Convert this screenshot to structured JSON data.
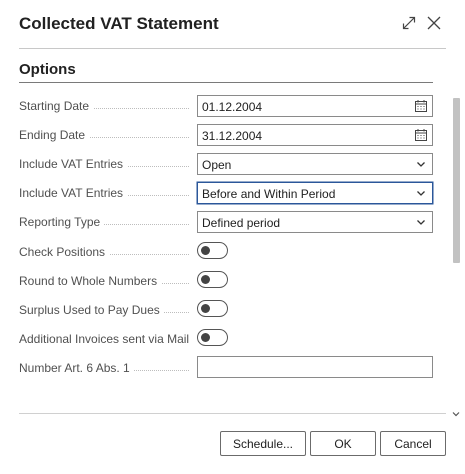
{
  "dialog": {
    "title": "Collected VAT Statement",
    "expand_icon": "expand-icon",
    "close_icon": "close-icon"
  },
  "section": {
    "title": "Options"
  },
  "fields": {
    "starting_date": {
      "label": "Starting Date",
      "value": "01.12.2004",
      "icon": "calendar-icon"
    },
    "ending_date": {
      "label": "Ending Date",
      "value": "31.12.2004",
      "icon": "calendar-icon"
    },
    "include_vat_entries_1": {
      "label": "Include VAT Entries",
      "value": "Open",
      "icon": "chevron-down-icon"
    },
    "include_vat_entries_2": {
      "label": "Include VAT Entries",
      "value": "Before and Within Period",
      "icon": "chevron-down-icon"
    },
    "reporting_type": {
      "label": "Reporting Type",
      "value": "Defined period",
      "icon": "chevron-down-icon"
    },
    "check_positions": {
      "label": "Check Positions",
      "checked": false
    },
    "round_to_whole_numbers": {
      "label": "Round to Whole Numbers",
      "checked": false
    },
    "surplus_used_to_pay_dues": {
      "label": "Surplus Used to Pay Dues",
      "checked": false
    },
    "additional_invoices_sent_via_mail": {
      "label": "Additional Invoices sent via Mail",
      "checked": false
    },
    "number_art_6_abs_1": {
      "label": "Number Art. 6 Abs. 1",
      "value": ""
    }
  },
  "buttons": {
    "schedule": "Schedule...",
    "ok": "OK",
    "cancel": "Cancel"
  },
  "colors": {
    "focus_border": "#2b579a",
    "field_border": "#8a8a8a",
    "label_text": "#505050",
    "scroll_thumb": "#c2c2c2"
  }
}
